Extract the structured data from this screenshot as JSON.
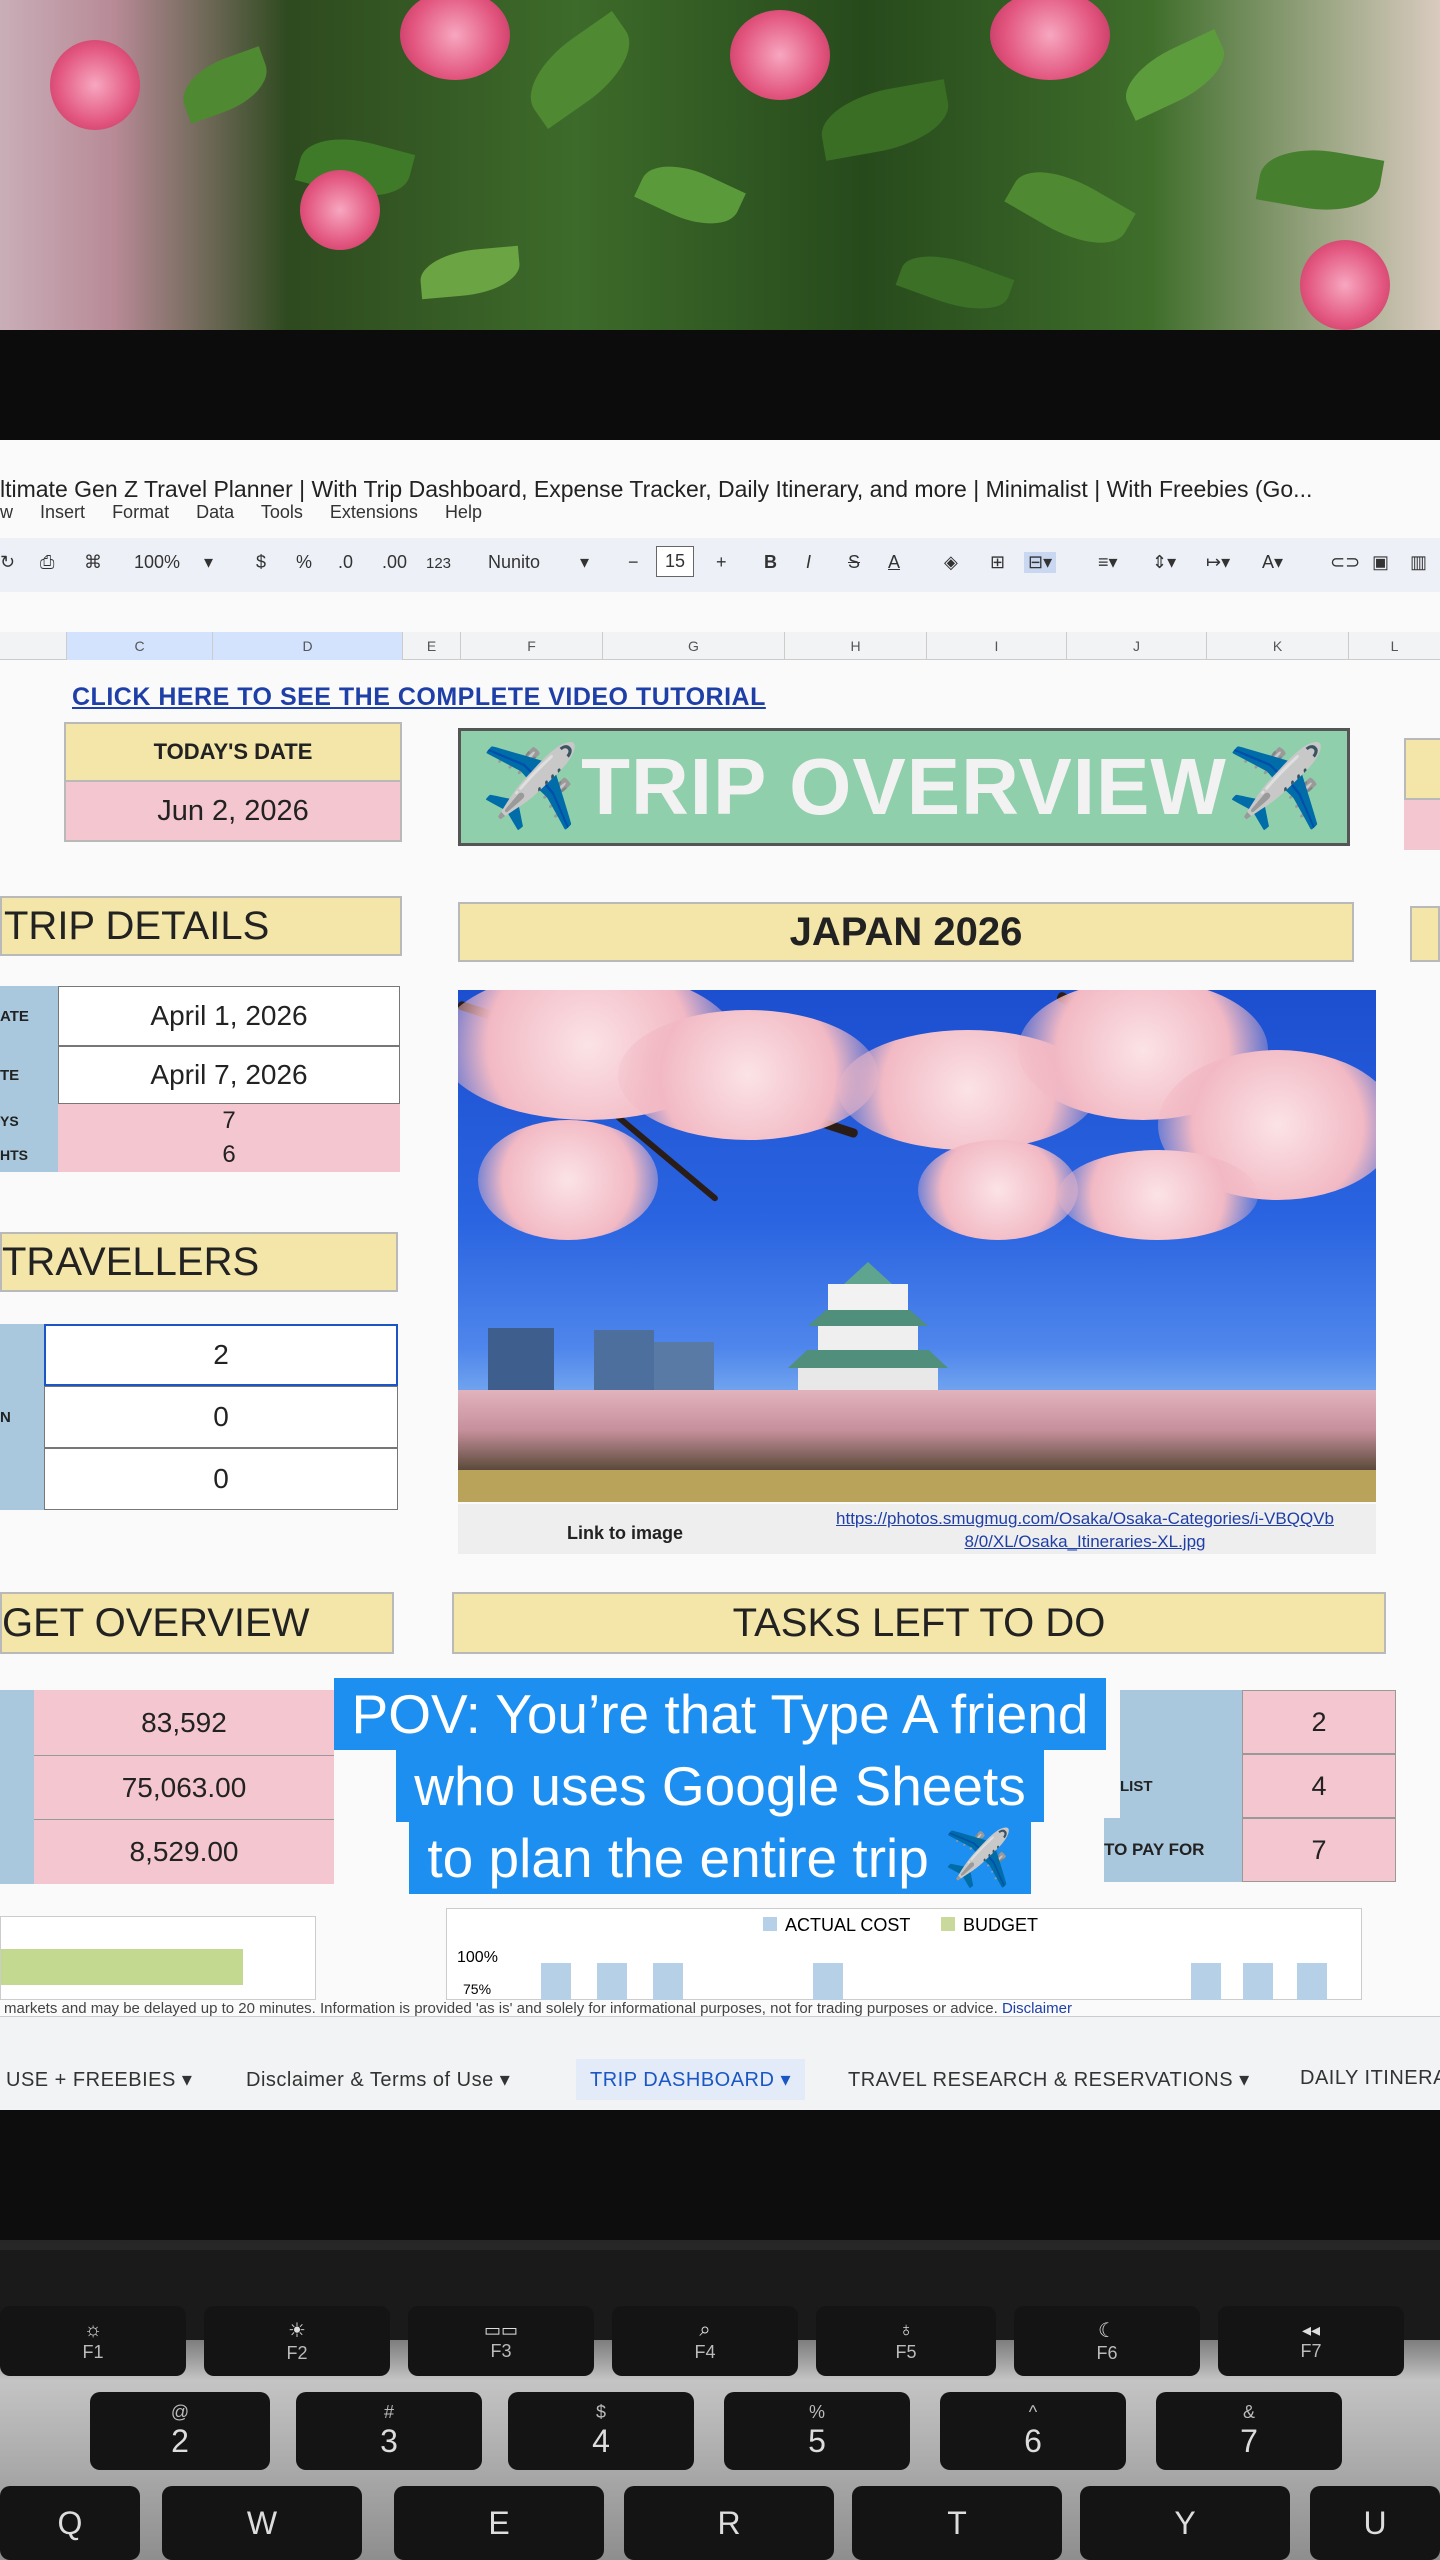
{
  "document": {
    "title": "ltimate Gen Z Travel Planner | With Trip Dashboard, Expense Tracker, Daily Itinerary, and more | Minimalist | With Freebies (Go...",
    "menu": [
      "w",
      "Insert",
      "Format",
      "Data",
      "Tools",
      "Extensions",
      "Help"
    ]
  },
  "toolbar": {
    "zoom": "100%",
    "currency": "$",
    "percent": "%",
    "decrease_decimal": ".0",
    "increase_decimal": ".00",
    "number_format": "123",
    "font": "Nunito",
    "font_size": "15",
    "minus": "−",
    "plus": "+",
    "bold": "B",
    "italic": "I",
    "strike": "S",
    "text_color": "A"
  },
  "columns": [
    "C",
    "D",
    "E",
    "F",
    "G",
    "H",
    "I",
    "J",
    "K",
    "L"
  ],
  "tutorial_link": "CLICK HERE TO SEE THE COMPLETE VIDEO TUTORIAL",
  "today": {
    "label": "TODAY'S DATE",
    "value": "Jun 2, 2026"
  },
  "overview_title": "✈️TRIP OVERVIEW✈️",
  "trip_details": {
    "heading": "TRIP DETAILS",
    "rows": [
      {
        "label": "ATE",
        "value": "April 1, 2026"
      },
      {
        "label": "TE",
        "value": "April 7, 2026"
      },
      {
        "label": "YS",
        "value": "7"
      },
      {
        "label": "HTS",
        "value": "6"
      }
    ]
  },
  "destination": {
    "heading": "JAPAN 2026",
    "image_link_label": "Link to image",
    "image_link_url_line1": "https://photos.smugmug.com/Osaka/Osaka-Categories/i-VBQQVb",
    "image_link_url_line2": "8/0/XL/Osaka_Itineraries-XL.jpg"
  },
  "travellers": {
    "heading": "TRAVELLERS",
    "rows": [
      {
        "label": "",
        "value": "2"
      },
      {
        "label": "N",
        "value": "0"
      },
      {
        "label": "",
        "value": "0"
      }
    ]
  },
  "budget": {
    "heading": "GET OVERVIEW",
    "rows": [
      "83,592",
      "75,063.00",
      "8,529.00"
    ]
  },
  "tasks": {
    "heading": "TASKS LEFT TO DO",
    "rows": [
      {
        "label": "",
        "value": "2"
      },
      {
        "label": "LIST",
        "value": "4"
      },
      {
        "label": "TO PAY FOR",
        "value": "7"
      }
    ]
  },
  "chart": {
    "legend_actual": "ACTUAL COST",
    "legend_budget": "BUDGET",
    "y_top": "100%",
    "y_next": "75%"
  },
  "disclaimer": {
    "text": "markets and may be delayed up to 20 minutes. Information is provided 'as is' and solely for informational purposes, not for trading purposes or advice.",
    "link": "Disclaimer"
  },
  "tabs": [
    {
      "label": "USE + FREEBIES ▾"
    },
    {
      "label": "Disclaimer & Terms of Use ▾"
    },
    {
      "label": "TRIP DASHBOARD ▾"
    },
    {
      "label": "TRAVEL RESEARCH & RESERVATIONS ▾"
    },
    {
      "label": "DAILY ITINERA"
    }
  ],
  "caption": {
    "line1": "POV: You’re that Type A friend",
    "line2": "who uses Google Sheets",
    "line3": "to plan the entire trip ✈️"
  },
  "keyboard": {
    "fn_row": [
      {
        "glyph": "☼",
        "label": "F1"
      },
      {
        "glyph": "☀",
        "label": "F2"
      },
      {
        "glyph": "▭▭",
        "label": "F3"
      },
      {
        "glyph": "⌕",
        "label": "F4"
      },
      {
        "glyph": "♁",
        "label": "F5"
      },
      {
        "glyph": "☾",
        "label": "F6"
      },
      {
        "glyph": "◂◂",
        "label": "F7"
      }
    ],
    "num_row": [
      {
        "top": "@",
        "bottom": "2"
      },
      {
        "top": "#",
        "bottom": "3"
      },
      {
        "top": "$",
        "bottom": "4"
      },
      {
        "top": "%",
        "bottom": "5"
      },
      {
        "top": "^",
        "bottom": "6"
      },
      {
        "top": "&",
        "bottom": "7"
      }
    ],
    "letter_row": [
      "Q",
      "W",
      "E",
      "R",
      "T",
      "Y",
      "U"
    ]
  }
}
